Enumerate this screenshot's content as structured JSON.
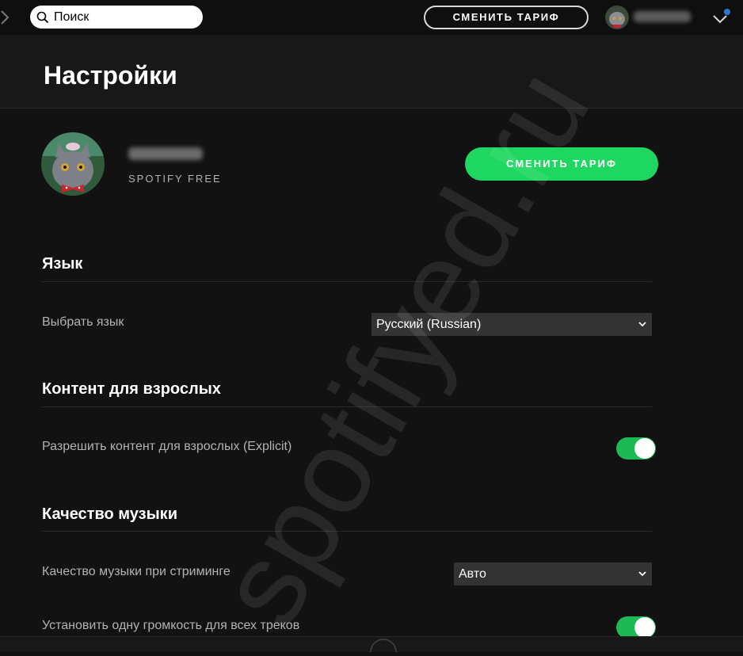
{
  "topbar": {
    "back_icon": "chevron-right-icon",
    "search_placeholder": "Поиск",
    "upgrade_label": "СМЕНИТЬ ТАРИФ"
  },
  "header": {
    "title": "Настройки"
  },
  "profile": {
    "plan": "SPOTIFY FREE",
    "upgrade_label": "СМЕНИТЬ ТАРИФ"
  },
  "sections": {
    "language": {
      "title": "Язык",
      "select_label": "Выбрать язык",
      "selected": "Русский (Russian)"
    },
    "explicit": {
      "title": "Контент для взрослых",
      "toggle_label": "Разрешить контент для взрослых (Explicit)",
      "enabled": true
    },
    "quality": {
      "title": "Качество музыки",
      "streaming_label": "Качество музыки при стриминге",
      "streaming_selected": "Авто",
      "normalize_label": "Установить одну громкость для всех треков",
      "normalize_enabled": true
    }
  },
  "watermark": "spotifyed.ru",
  "colors": {
    "accent_green": "#1ed760",
    "toggle_green": "#1db954",
    "background": "#121212",
    "notification_blue": "#2e77d0"
  }
}
